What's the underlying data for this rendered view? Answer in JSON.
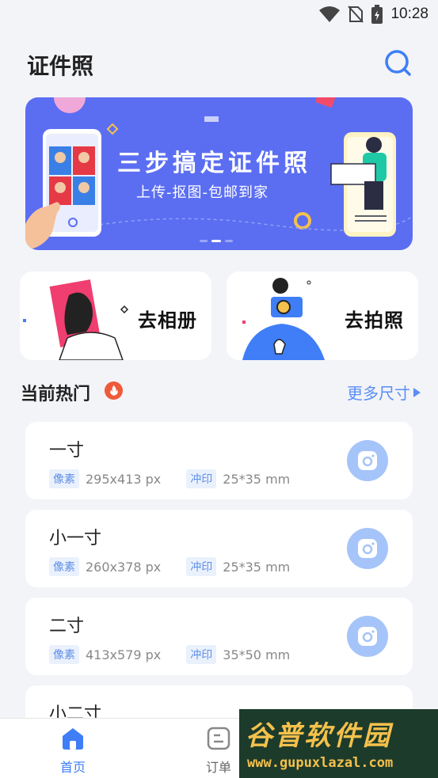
{
  "status_bar": {
    "time": "10:28"
  },
  "header": {
    "title": "证件照"
  },
  "banner": {
    "headline": "三步搞定证件照",
    "subline": "上传-抠图-包邮到家",
    "slide_count": 3,
    "active_slide": 2
  },
  "cards": [
    {
      "label": "去相册"
    },
    {
      "label": "去拍照"
    }
  ],
  "hot": {
    "title": "当前热门",
    "more": "更多尺寸"
  },
  "size_list": [
    {
      "name": "一寸",
      "pixel_tag": "像素",
      "pixels": "295x413 px",
      "print_tag": "冲印",
      "print": "25*35 mm"
    },
    {
      "name": "小一寸",
      "pixel_tag": "像素",
      "pixels": "260x378 px",
      "print_tag": "冲印",
      "print": "25*35 mm"
    },
    {
      "name": "二寸",
      "pixel_tag": "像素",
      "pixels": "413x579 px",
      "print_tag": "冲印",
      "print": "35*50 mm"
    },
    {
      "name": "小二寸"
    }
  ],
  "tabbar": {
    "home": "首页",
    "orders": "订单"
  },
  "watermark": {
    "text": "谷普软件园",
    "url": "www.gupuxlazal.com"
  },
  "colors": {
    "accent": "#3f7ef6",
    "banner": "#5b6ef2",
    "camera_button": "#a5c4f9"
  }
}
